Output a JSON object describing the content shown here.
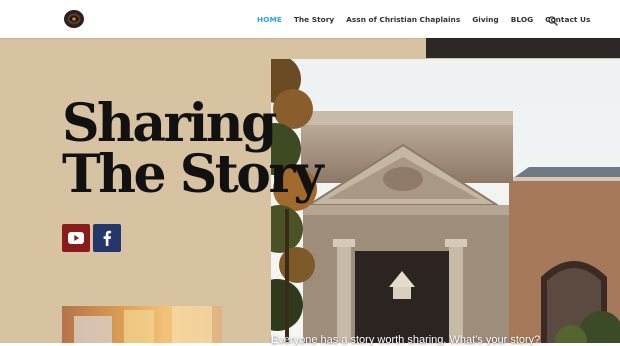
{
  "header": {
    "logo": "logo-emblem",
    "nav": [
      {
        "label": "HOME",
        "active": true
      },
      {
        "label": "The Story",
        "active": false
      },
      {
        "label": "Assn of Christian Chaplains",
        "active": false
      },
      {
        "label": "Giving",
        "active": false
      },
      {
        "label": "BLOG",
        "active": false
      },
      {
        "label": "Contact Us",
        "active": false
      }
    ],
    "search_icon": "search-icon"
  },
  "hero": {
    "title_line1": "Sharing",
    "title_line2": "The Story",
    "tagline": "Everyone has a story worth sharing.  What's your story?",
    "social": [
      {
        "name": "youtube",
        "icon": "youtube-icon",
        "color": "#8a1b1b"
      },
      {
        "name": "facebook",
        "icon": "facebook-icon",
        "color": "#23376b"
      }
    ]
  },
  "colors": {
    "accent": "#2ea3f2",
    "hero_bg": "#d7c2a2",
    "text_dark": "#111111"
  }
}
